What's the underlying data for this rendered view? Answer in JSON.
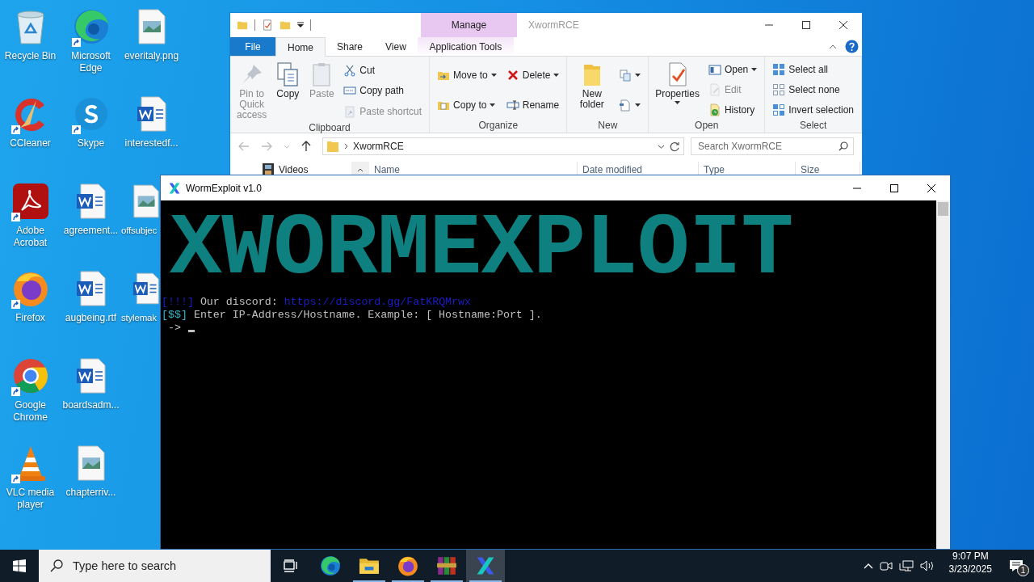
{
  "desktop": {
    "columns": [
      {
        "icons": [
          {
            "label": "Recycle Bin",
            "kind": "recycle",
            "shortcut": false,
            "covered": false
          },
          {
            "label": "CCleaner",
            "kind": "ccleaner",
            "shortcut": true,
            "covered": false
          },
          {
            "label": "Adobe Acrobat",
            "kind": "acrobat",
            "shortcut": true,
            "covered": false
          },
          {
            "label": "Firefox",
            "kind": "firefox",
            "shortcut": true,
            "covered": false
          },
          {
            "label": "Google Chrome",
            "kind": "chrome",
            "shortcut": true,
            "covered": false
          },
          {
            "label": "VLC media player",
            "kind": "vlc",
            "shortcut": true,
            "covered": false
          }
        ]
      },
      {
        "icons": [
          {
            "label": "Microsoft Edge",
            "kind": "edge",
            "shortcut": true,
            "covered": false
          },
          {
            "label": "Skype",
            "kind": "skype",
            "shortcut": true,
            "covered": false
          },
          {
            "label": "agreement...",
            "kind": "word",
            "shortcut": false,
            "covered": false
          },
          {
            "label": "augbeing.rtf",
            "kind": "word",
            "shortcut": false,
            "covered": false
          },
          {
            "label": "boardsadm...",
            "kind": "word",
            "shortcut": false,
            "covered": false
          },
          {
            "label": "chapterriv...",
            "kind": "image",
            "shortcut": false,
            "covered": false
          }
        ]
      },
      {
        "icons": [
          {
            "label": "everitaly.png",
            "kind": "image",
            "shortcut": false,
            "covered": false
          },
          {
            "label": "interestedf...",
            "kind": "word",
            "shortcut": false,
            "covered": false
          },
          {
            "label": "offsubjec",
            "kind": "image",
            "shortcut": false,
            "covered": true
          },
          {
            "label": "stylemak",
            "kind": "word",
            "shortcut": false,
            "covered": true
          }
        ]
      }
    ]
  },
  "explorer": {
    "context_tab": "Manage",
    "title": "XwormRCE",
    "tabs": [
      {
        "label": "File",
        "kind": "file",
        "selected": false
      },
      {
        "label": "Home",
        "kind": "normal",
        "selected": true
      },
      {
        "label": "Share",
        "kind": "normal",
        "selected": false
      },
      {
        "label": "View",
        "kind": "normal",
        "selected": false
      },
      {
        "label": "Application Tools",
        "kind": "context",
        "selected": false
      }
    ],
    "ribbon": [
      {
        "label": "Clipboard",
        "columns": [
          {
            "kind": "large",
            "items": [
              {
                "label": "Pin to Quick access",
                "kind": "pin",
                "disabled": true,
                "dropdown": false
              }
            ]
          },
          {
            "kind": "large",
            "items": [
              {
                "label": "Copy",
                "kind": "copy",
                "disabled": false,
                "dropdown": false
              }
            ]
          },
          {
            "kind": "large",
            "items": [
              {
                "label": "Paste",
                "kind": "paste",
                "disabled": true,
                "dropdown": false
              }
            ]
          },
          {
            "kind": "small",
            "items": [
              {
                "label": "Cut",
                "kind": "cut",
                "disabled": false,
                "dropdown": false
              },
              {
                "label": "Copy path",
                "kind": "copypath",
                "disabled": false,
                "dropdown": false
              },
              {
                "label": "Paste shortcut",
                "kind": "pasteshortcut",
                "disabled": true,
                "dropdown": false
              }
            ]
          }
        ]
      },
      {
        "label": "Organize",
        "columns": [
          {
            "kind": "small",
            "items": [
              {
                "label": "Move to",
                "kind": "moveto",
                "disabled": false,
                "dropdown": true
              },
              {
                "label": "Copy to",
                "kind": "copyto",
                "disabled": false,
                "dropdown": true
              }
            ]
          },
          {
            "kind": "small",
            "items": [
              {
                "label": "Delete",
                "kind": "delete",
                "disabled": false,
                "dropdown": true
              },
              {
                "label": "Rename",
                "kind": "rename",
                "disabled": false,
                "dropdown": false
              }
            ]
          }
        ]
      },
      {
        "label": "New",
        "columns": [
          {
            "kind": "large",
            "items": [
              {
                "label": "New folder",
                "kind": "newfolder",
                "disabled": false,
                "dropdown": false
              }
            ]
          },
          {
            "kind": "small",
            "items": [
              {
                "kind": "newitem",
                "disabled": false,
                "dropdown": true
              },
              {
                "kind": "easyaccess",
                "disabled": false,
                "dropdown": true
              }
            ]
          }
        ]
      },
      {
        "label": "Open",
        "columns": [
          {
            "kind": "large",
            "items": [
              {
                "label": "Properties",
                "kind": "properties",
                "disabled": false,
                "dropdown": true
              }
            ]
          },
          {
            "kind": "small",
            "items": [
              {
                "label": "Open",
                "kind": "open",
                "disabled": false,
                "dropdown": true
              },
              {
                "label": "Edit",
                "kind": "edit",
                "disabled": true,
                "dropdown": false
              },
              {
                "label": "History",
                "kind": "history",
                "disabled": false,
                "dropdown": false
              }
            ]
          }
        ]
      },
      {
        "label": "Select",
        "columns": [
          {
            "kind": "small",
            "items": [
              {
                "label": "Select all",
                "kind": "selectall",
                "disabled": false,
                "dropdown": false
              },
              {
                "label": "Select none",
                "kind": "selectnone",
                "disabled": false,
                "dropdown": false
              },
              {
                "label": "Invert selection",
                "kind": "invert",
                "disabled": false,
                "dropdown": false
              }
            ]
          }
        ]
      }
    ],
    "address": "XwormRCE",
    "search": {
      "placeholder": "Search XwormRCE"
    },
    "nav_item": "Videos",
    "columns": [
      "Name",
      "Date modified",
      "Type",
      "Size"
    ]
  },
  "console": {
    "title": "WormExploit v1.0",
    "banner": "XWORMEXPLOIT",
    "lines": [
      {
        "segments": [
          {
            "text": "[!!!]",
            "color": "#1c1cc8"
          },
          {
            "text": " Our discord: ",
            "color": "#c0c0c0"
          },
          {
            "text": "https://discord.gg/FatKRQMrwx",
            "color": "#1c1cc8"
          }
        ],
        "cursor": false
      },
      {
        "segments": [
          {
            "text": "[$$]",
            "color": "#3ab4c8"
          },
          {
            "text": " Enter IP-Address/Hostname. Example: [ Hostname:Port ].",
            "color": "#c0c0c0"
          }
        ],
        "cursor": false
      },
      {
        "segments": [
          {
            "text": " ->",
            "color": "#c0c0c0"
          }
        ],
        "cursor": true
      }
    ]
  },
  "taskbar": {
    "search": {
      "placeholder": "Type here to search"
    },
    "apps": [
      {
        "kind": "edge",
        "running": false,
        "selected": false
      },
      {
        "kind": "explorer",
        "running": true,
        "selected": false
      },
      {
        "kind": "firefox",
        "running": true,
        "selected": false
      },
      {
        "kind": "winrar",
        "running": true,
        "selected": false
      },
      {
        "kind": "xworm",
        "running": true,
        "selected": true
      }
    ],
    "time": "9:07 PM",
    "date": "3/23/2025",
    "notifications": "1"
  }
}
